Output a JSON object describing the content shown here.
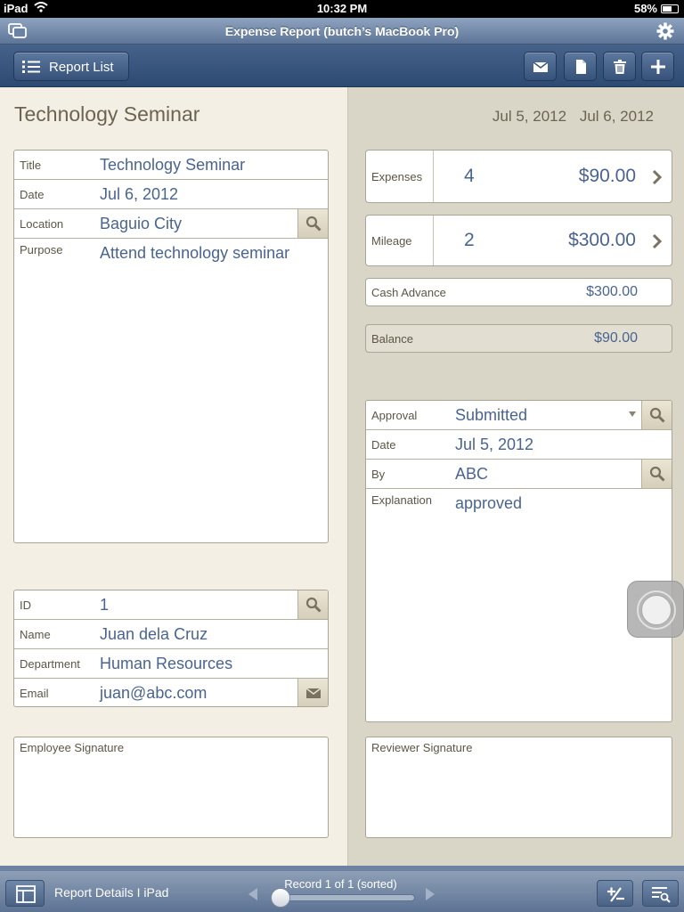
{
  "status_bar": {
    "device": "iPad",
    "time": "10:32 PM",
    "battery": "58%"
  },
  "window": {
    "title": "Expense Report (butch’s MacBook Pro)"
  },
  "toolbar": {
    "report_list_label": "Report List",
    "actions": [
      "email-icon",
      "new-record-icon",
      "trash-icon",
      "plus-icon"
    ]
  },
  "report": {
    "heading": "Technology Seminar",
    "start_date": "Jul 5, 2012",
    "end_date": "Jul 6, 2012",
    "fields": {
      "title": {
        "label": "Title",
        "value": "Technology Seminar"
      },
      "date": {
        "label": "Date",
        "value": "Jul 6, 2012"
      },
      "location": {
        "label": "Location",
        "value": "Baguio City"
      },
      "purpose": {
        "label": "Purpose",
        "value": "Attend technology seminar"
      }
    }
  },
  "employee": {
    "id": {
      "label": "ID",
      "value": "1"
    },
    "name": {
      "label": "Name",
      "value": "Juan dela Cruz"
    },
    "department": {
      "label": "Department",
      "value": "Human Resources"
    },
    "email": {
      "label": "Email",
      "value": "juan@abc.com"
    },
    "signature_label": "Employee Signature"
  },
  "summary": {
    "expenses": {
      "label": "Expenses",
      "count": "4",
      "amount": "$90.00"
    },
    "mileage": {
      "label": "Mileage",
      "count": "2",
      "amount": "$300.00"
    },
    "cash_advance": {
      "label": "Cash Advance",
      "amount": "$300.00"
    },
    "balance": {
      "label": "Balance",
      "amount": "$90.00"
    }
  },
  "approval": {
    "status": {
      "label": "Approval",
      "value": "Submitted"
    },
    "date": {
      "label": "Date",
      "value": "Jul 5, 2012"
    },
    "by": {
      "label": "By",
      "value": "ABC"
    },
    "explanation": {
      "label": "Explanation",
      "value": "approved"
    },
    "signature_label": "Reviewer Signature"
  },
  "bottom_bar": {
    "layout_name": "Report Details I iPad",
    "record_text": "Record 1 of 1 (sorted)",
    "record_position": 1,
    "record_total": 1
  }
}
